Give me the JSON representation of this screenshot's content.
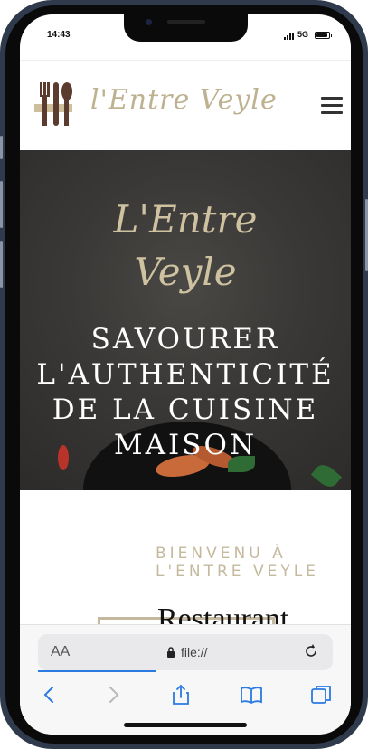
{
  "status": {
    "time": "14:43",
    "network": "5G"
  },
  "site": {
    "logo_text": "l'Entre Veyle",
    "hero": {
      "script_line1": "L'Entre",
      "script_line2": "Veyle",
      "title_line1": "SAVOURER",
      "title_line2": "L'AUTHENTICITÉ",
      "title_line3": "DE LA CUISINE",
      "title_line4": "MAISON"
    },
    "welcome": {
      "kicker_line1": "BIENVENU À",
      "kicker_line2": "L'ENTRE VEYLE",
      "heading": "Restaurant"
    }
  },
  "browser": {
    "aa_label": "AA",
    "url": "file://"
  },
  "icons": [
    "signal-icon",
    "battery-icon",
    "fork-knife-logo-icon",
    "hamburger-icon",
    "lock-icon",
    "reload-icon",
    "back-icon",
    "forward-icon",
    "share-icon",
    "bookmarks-icon",
    "tabs-icon"
  ],
  "colors": {
    "accent_gold": "#c4b99c",
    "hero_bg": "#3a3836",
    "link_blue": "#2a7ae2"
  }
}
